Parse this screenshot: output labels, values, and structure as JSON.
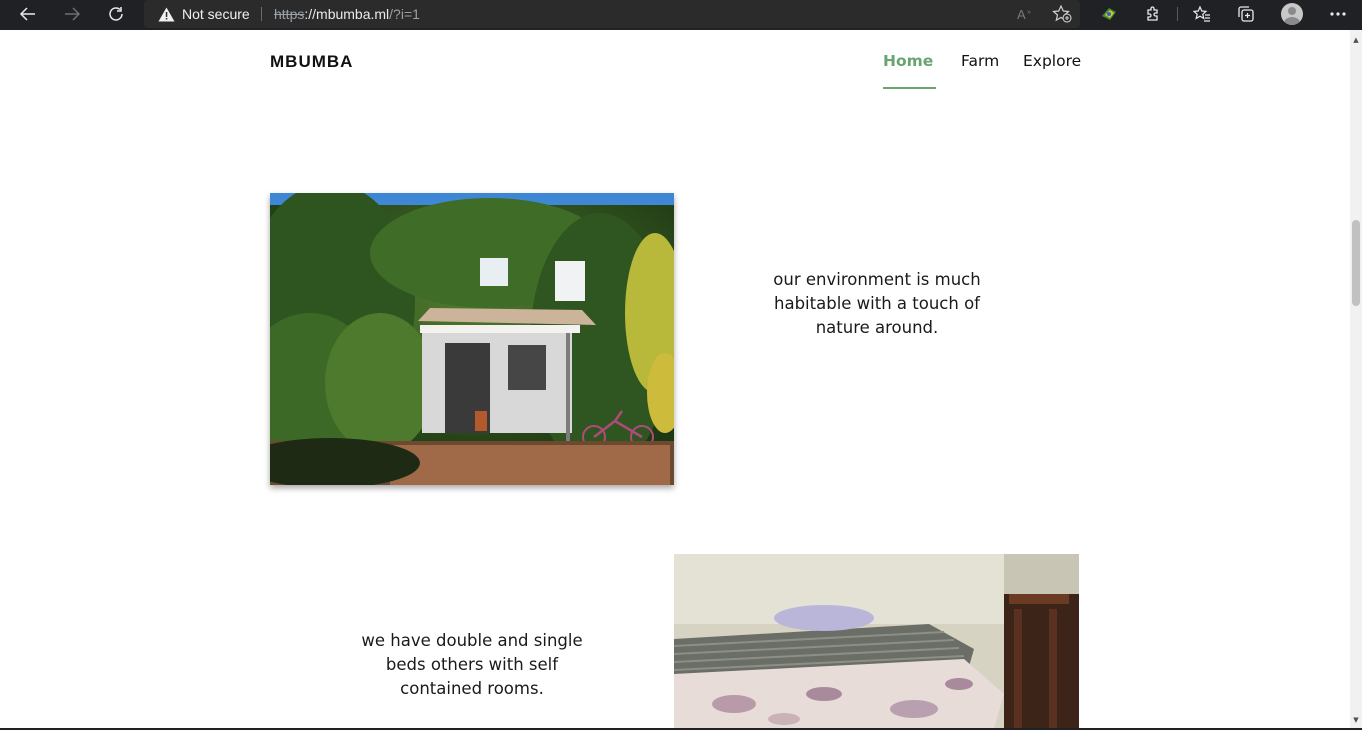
{
  "browser": {
    "security_label": "Not secure",
    "url_scheme": "https",
    "url_host": "://mbumba.ml",
    "url_path": "/?i=1"
  },
  "site": {
    "brand": "MBUMBA",
    "nav": [
      {
        "label": "Home",
        "active": true
      },
      {
        "label": "Farm",
        "active": false
      },
      {
        "label": "Explore",
        "active": false
      }
    ]
  },
  "sections": [
    {
      "caption": "our environment is much habitable with a touch of nature around."
    },
    {
      "caption": "we have double and single beds others with self contained rooms."
    }
  ],
  "colors": {
    "accent": "#6aa56f",
    "chrome": "#202124"
  }
}
